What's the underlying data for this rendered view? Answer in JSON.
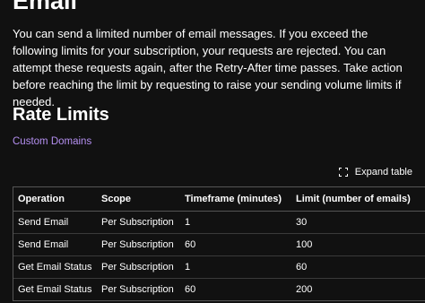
{
  "page": {
    "title": "Email",
    "intro": "You can send a limited number of email messages. If you exceed the following limits for your subscription, your requests are rejected. You can attempt these requests again, after the Retry-After time passes. Take action before reaching the limit by requesting to raise your sending volume limits if needed."
  },
  "section": {
    "title": "Rate Limits",
    "link_label": "Custom Domains"
  },
  "toolbar": {
    "expand_label": "Expand table",
    "expand_icon": "expand-icon"
  },
  "table": {
    "headers": {
      "operation": "Operation",
      "scope": "Scope",
      "timeframe": "Timeframe (minutes)",
      "limit": "Limit (number of emails)"
    },
    "rows": [
      {
        "operation": "Send Email",
        "scope": "Per Subscription",
        "timeframe": "1",
        "limit": "30"
      },
      {
        "operation": "Send Email",
        "scope": "Per Subscription",
        "timeframe": "60",
        "limit": "100"
      },
      {
        "operation": "Get Email Status",
        "scope": "Per Subscription",
        "timeframe": "1",
        "limit": "60"
      },
      {
        "operation": "Get Email Status",
        "scope": "Per Subscription",
        "timeframe": "60",
        "limit": "200"
      }
    ]
  },
  "colors": {
    "background": "#111111",
    "text": "#ffffff",
    "link": "#b48ff0",
    "border": "#555555"
  }
}
